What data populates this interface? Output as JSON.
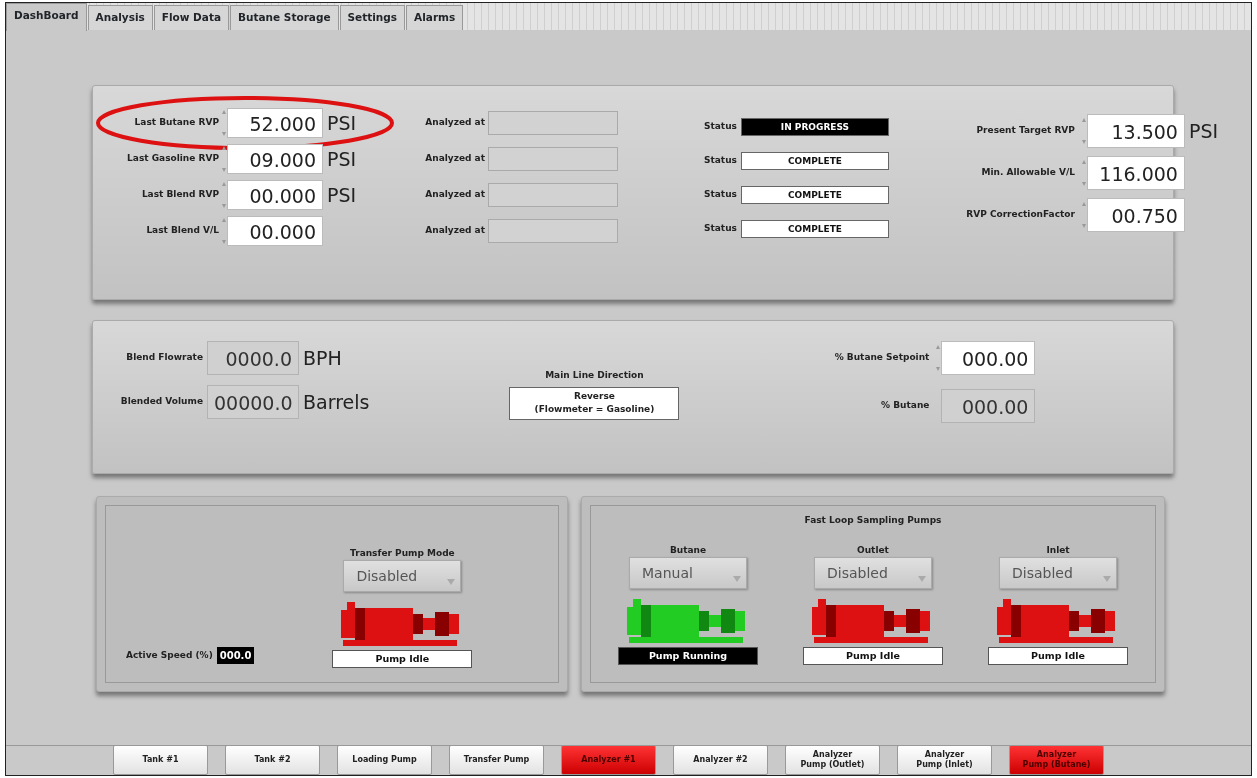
{
  "tabs": [
    {
      "label": "DashBoard",
      "selected": true
    },
    {
      "label": "Analysis",
      "selected": false
    },
    {
      "label": "Flow Data",
      "selected": false
    },
    {
      "label": "Butane Storage",
      "selected": false
    },
    {
      "label": "Settings",
      "selected": false
    },
    {
      "label": "Alarms",
      "selected": false
    }
  ],
  "analysis": {
    "readings": [
      {
        "label": "Last Butane RVP",
        "value": "52.000",
        "unit": "PSI",
        "analyzed_label": "Analyzed at",
        "status_label": "Status",
        "status": "IN PROGRESS",
        "status_active": true,
        "circled": true
      },
      {
        "label": "Last Gasoline RVP",
        "value": "09.000",
        "unit": "PSI",
        "analyzed_label": "Analyzed at",
        "status_label": "Status",
        "status": "COMPLETE",
        "status_active": false,
        "circled": false
      },
      {
        "label": "Last Blend RVP",
        "value": "00.000",
        "unit": "PSI",
        "analyzed_label": "Analyzed at",
        "status_label": "Status",
        "status": "COMPLETE",
        "status_active": false,
        "circled": false
      },
      {
        "label": "Last Blend V/L",
        "value": "00.000",
        "analyzed_label": "Analyzed at",
        "status_label": "Status",
        "status": "COMPLETE",
        "status_active": false,
        "circled": false
      }
    ],
    "settings": [
      {
        "label": "Present Target RVP",
        "value": "13.500",
        "unit": "PSI"
      },
      {
        "label": "Min. Allowable V/L",
        "value": "116.000"
      },
      {
        "label": "RVP CorrectionFactor",
        "value": "00.750"
      }
    ]
  },
  "flow": {
    "indicators": [
      {
        "label": "Blend Flowrate",
        "value": "0000.0",
        "unit": "BPH"
      },
      {
        "label": "Blended Volume",
        "value": "00000.0",
        "unit": "Barrels"
      }
    ],
    "direction": {
      "label": "Main Line Direction",
      "lines": [
        "Reverse",
        "(Flowmeter = Gasoline)"
      ]
    },
    "butane": [
      {
        "label": "% Butane Setpoint",
        "value": "000.00",
        "kind": "control"
      },
      {
        "label": "% Butane",
        "value": "000.00",
        "kind": "indicator"
      }
    ]
  },
  "transfer": {
    "speed_label": "Active Speed (%)",
    "speed": "000.0",
    "pump": {
      "label": "Transfer Pump Mode",
      "mode": "Disabled",
      "status": "Pump Idle",
      "running": false
    }
  },
  "sampling": {
    "title": "Fast Loop Sampling Pumps",
    "pumps": [
      {
        "label": "Butane",
        "mode": "Manual",
        "status": "Pump Running",
        "running": true
      },
      {
        "label": "Outlet",
        "mode": "Disabled",
        "status": "Pump Idle",
        "running": false
      },
      {
        "label": "Inlet",
        "mode": "Disabled",
        "status": "Pump Idle",
        "running": false
      }
    ]
  },
  "nav_buttons": [
    {
      "lines": [
        "Tank #1"
      ],
      "alarm": false
    },
    {
      "lines": [
        "Tank #2"
      ],
      "alarm": false
    },
    {
      "lines": [
        "Loading Pump"
      ],
      "alarm": false
    },
    {
      "lines": [
        "Transfer Pump"
      ],
      "alarm": false
    },
    {
      "lines": [
        "Analyzer #1"
      ],
      "alarm": true
    },
    {
      "lines": [
        "Analyzer #2"
      ],
      "alarm": false
    },
    {
      "lines": [
        "Analyzer",
        "Pump (Outlet)"
      ],
      "alarm": false
    },
    {
      "lines": [
        "Analyzer",
        "Pump (Inlet)"
      ],
      "alarm": false
    },
    {
      "lines": [
        "Analyzer",
        "Pump (Butane)"
      ],
      "alarm": true
    }
  ]
}
